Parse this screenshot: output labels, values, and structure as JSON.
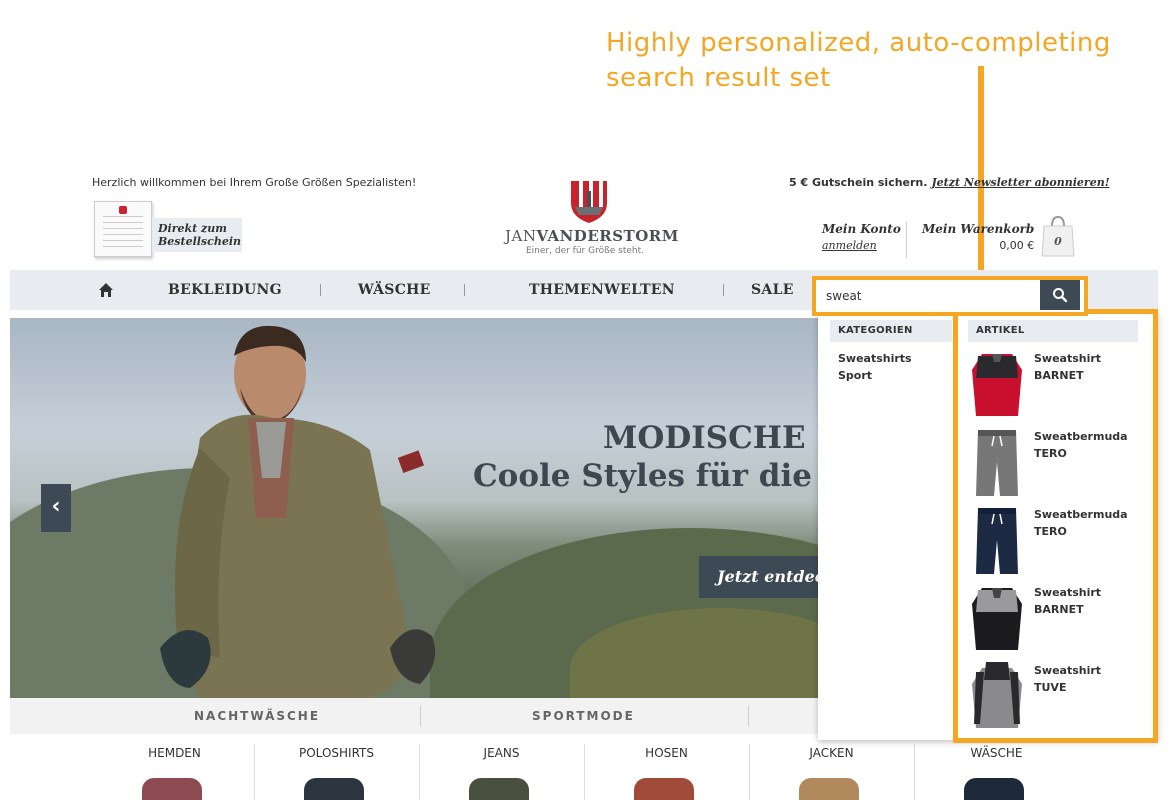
{
  "annotation": {
    "text": "Highly personalized, auto-completing search result set",
    "color": "#f5a623"
  },
  "header": {
    "welcome": "Herzlich willkommen bei Ihrem Große Größen Spezialisten!",
    "order_form_label": "Direkt zum Bestellschein",
    "logo_brand_light": "JAN",
    "logo_brand_bold": "VANDERSTORM",
    "logo_tagline": "Einer, der für Größe steht.",
    "voucher_text": "5 € Gutschein sichern.",
    "voucher_link": "Jetzt Newsletter abonnieren!",
    "account_title": "Mein Konto",
    "account_link": "anmelden",
    "cart_title": "Mein Warenkorb",
    "cart_price": "0,00 €",
    "cart_count": "0"
  },
  "nav": {
    "items": [
      "BEKLEIDUNG",
      "WÄSCHE",
      "THEMENWELTEN",
      "SALE"
    ]
  },
  "search": {
    "value": "sweat"
  },
  "hero": {
    "title_line1": "MODISCHE E",
    "title_line2": "Coole Styles für die k",
    "cta": "Jetzt entdec",
    "prev_label": "‹"
  },
  "subnav": {
    "items": [
      "NACHTWÄSCHE",
      "SPORTMODE"
    ]
  },
  "categories": {
    "items": [
      "HEMDEN",
      "POLOSHIRTS",
      "JEANS",
      "HOSEN",
      "JACKEN",
      "WÄSCHE"
    ]
  },
  "dropdown": {
    "categories_header": "KATEGORIEN",
    "articles_header": "ARTIKEL",
    "category_items": [
      "Sweatshirts",
      "Sport"
    ],
    "products": [
      {
        "name": "Sweatshirt BARNET"
      },
      {
        "name": "Sweatbermuda TERO"
      },
      {
        "name": "Sweatbermuda TERO"
      },
      {
        "name": "Sweatshirt BARNET"
      },
      {
        "name": "Sweatshirt TUVE"
      }
    ]
  },
  "colors": {
    "accent": "#f5a623",
    "nav_bg": "#e8ecf0",
    "dark_button": "#3d4a55"
  }
}
